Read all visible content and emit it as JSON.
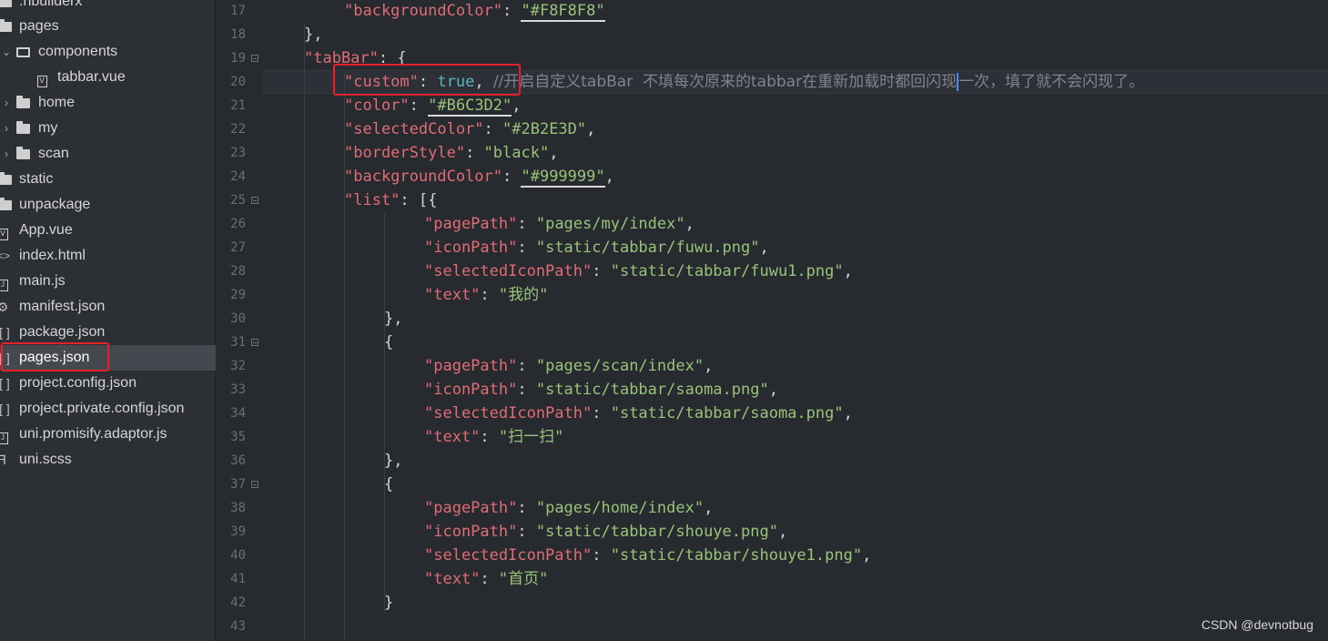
{
  "sidebar": {
    "items": [
      {
        "label": ".hbuilderx",
        "type": "folder"
      },
      {
        "label": "pages",
        "type": "folder"
      },
      {
        "label": "components",
        "type": "folder-open"
      },
      {
        "label": "tabbar.vue",
        "type": "vue-file"
      },
      {
        "label": "home",
        "type": "folder"
      },
      {
        "label": "my",
        "type": "folder"
      },
      {
        "label": "scan",
        "type": "folder"
      },
      {
        "label": "static",
        "type": "folder"
      },
      {
        "label": "unpackage",
        "type": "folder"
      },
      {
        "label": "App.vue",
        "type": "vue-file"
      },
      {
        "label": "index.html",
        "type": "html-file"
      },
      {
        "label": "main.js",
        "type": "js-file"
      },
      {
        "label": "manifest.json",
        "type": "settings-file"
      },
      {
        "label": "package.json",
        "type": "json-file"
      },
      {
        "label": "pages.json",
        "type": "json-file"
      },
      {
        "label": "project.config.json",
        "type": "json-file"
      },
      {
        "label": "project.private.config.json",
        "type": "json-file"
      },
      {
        "label": "uni.promisify.adaptor.js",
        "type": "js-file"
      },
      {
        "label": "uni.scss",
        "type": "scss-file"
      }
    ],
    "selected": "pages.json"
  },
  "editor": {
    "line_numbers": [
      "17",
      "18",
      "19",
      "20",
      "21",
      "22",
      "23",
      "24",
      "25",
      "26",
      "27",
      "28",
      "29",
      "30",
      "31",
      "32",
      "33",
      "34",
      "35",
      "36",
      "37",
      "38",
      "39",
      "40",
      "41",
      "42",
      "43"
    ],
    "lines": {
      "l17": {
        "key": "\"backgroundColor\"",
        "colon": ": ",
        "val": "\"#F8F8F8\""
      },
      "l18": "},",
      "l19": {
        "key": "\"tabBar\"",
        "rest": ": {"
      },
      "l20": {
        "key": "\"custom\"",
        "colon": ": ",
        "bool": "true",
        "comma": ", ",
        "comment_a": "//开启自定义tabBar  不填每次原来的tabbar在重新加载时都回闪现",
        "comment_b": "一次，填了就不会闪现了。"
      },
      "l21": {
        "key": "\"color\"",
        "colon": ": ",
        "val": "\"#B6C3D2\"",
        "comma": ","
      },
      "l22": {
        "key": "\"selectedColor\"",
        "colon": ": ",
        "val": "\"#2B2E3D\"",
        "comma": ","
      },
      "l23": {
        "key": "\"borderStyle\"",
        "colon": ": ",
        "val": "\"black\"",
        "comma": ","
      },
      "l24": {
        "key": "\"backgroundColor\"",
        "colon": ": ",
        "val": "\"#999999\"",
        "comma": ","
      },
      "l25": {
        "key": "\"list\"",
        "rest": ": [{"
      },
      "l26": {
        "key": "\"pagePath\"",
        "colon": ": ",
        "val": "\"pages/my/index\"",
        "comma": ","
      },
      "l27": {
        "key": "\"iconPath\"",
        "colon": ": ",
        "val": "\"static/tabbar/fuwu.png\"",
        "comma": ","
      },
      "l28": {
        "key": "\"selectedIconPath\"",
        "colon": ": ",
        "val": "\"static/tabbar/fuwu1.png\"",
        "comma": ","
      },
      "l29": {
        "key": "\"text\"",
        "colon": ": ",
        "val": "\"我的\""
      },
      "l30": "},",
      "l31": "{",
      "l32": {
        "key": "\"pagePath\"",
        "colon": ": ",
        "val": "\"pages/scan/index\"",
        "comma": ","
      },
      "l33": {
        "key": "\"iconPath\"",
        "colon": ": ",
        "val": "\"static/tabbar/saoma.png\"",
        "comma": ","
      },
      "l34": {
        "key": "\"selectedIconPath\"",
        "colon": ": ",
        "val": "\"static/tabbar/saoma.png\"",
        "comma": ","
      },
      "l35": {
        "key": "\"text\"",
        "colon": ": ",
        "val": "\"扫一扫\""
      },
      "l36": "},",
      "l37": "{",
      "l38": {
        "key": "\"pagePath\"",
        "colon": ": ",
        "val": "\"pages/home/index\"",
        "comma": ","
      },
      "l39": {
        "key": "\"iconPath\"",
        "colon": ": ",
        "val": "\"static/tabbar/shouye.png\"",
        "comma": ","
      },
      "l40": {
        "key": "\"selectedIconPath\"",
        "colon": ": ",
        "val": "\"static/tabbar/shouye1.png\"",
        "comma": ","
      },
      "l41": {
        "key": "\"text\"",
        "colon": ": ",
        "val": "\"首页\""
      },
      "l42": "}"
    }
  },
  "watermark": "CSDN @devnotbug",
  "colors": {
    "key": "#e06c75",
    "string": "#98c379",
    "bool": "#56b6c2",
    "comment": "#7f848e",
    "highlight": "#e52229"
  }
}
